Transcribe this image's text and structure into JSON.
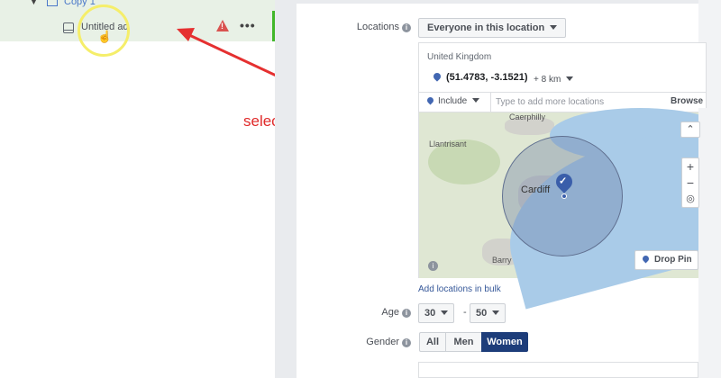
{
  "tree": {
    "copy_label": "Copy 1",
    "ad_label": "Untitled ad",
    "warning_symbol": "!",
    "more_symbol": "•••"
  },
  "annotation": {
    "text": "select or create the ad",
    "color": "#e02a2a"
  },
  "locations": {
    "label": "Locations",
    "audience_type": "Everyone in this location",
    "country": "United Kingdom",
    "coordinates": "(51.4783, -3.1521)",
    "radius": "+ 8 km",
    "include_label": "Include",
    "search_placeholder": "Type to add more locations",
    "browse_label": "Browse",
    "map_places": {
      "caerphilly": "Caerphilly",
      "llantrisant": "Llantrisant",
      "cardiff": "Cardiff",
      "barry": "Barry"
    },
    "drop_pin_label": "Drop Pin",
    "bulk_label": "Add locations in bulk"
  },
  "age": {
    "label": "Age",
    "min": "30",
    "max": "50",
    "separator": "-"
  },
  "gender": {
    "label": "Gender",
    "options": [
      "All",
      "Men",
      "Women"
    ],
    "selected": "Women"
  },
  "icons": {
    "info": "i",
    "pin_check": "✓",
    "zoom_in": "+",
    "zoom_out": "−",
    "chevron_up": "⌃"
  },
  "colors": {
    "accent": "#1d3d7a",
    "success": "#42b72a",
    "link": "#365899"
  }
}
